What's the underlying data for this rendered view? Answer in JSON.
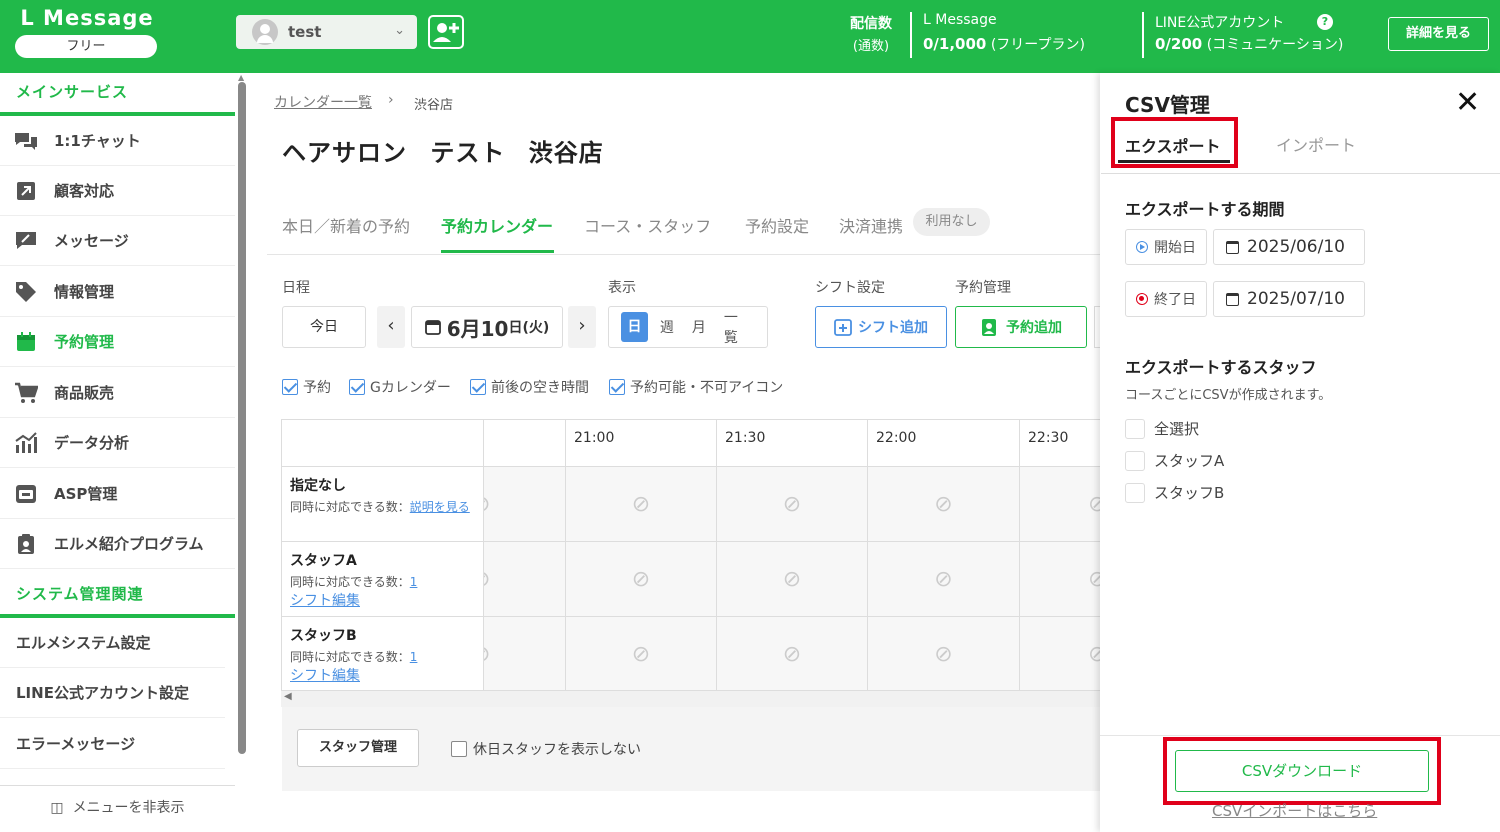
{
  "header": {
    "logo": "L Message",
    "plan": "フリー",
    "account": "test",
    "send_label": "配信数",
    "send_sub": "(通数)",
    "lmessage_title": "L Message",
    "lmessage_value": "0/1,000",
    "lmessage_plan": "(フリープラン)",
    "line_title": "LINE公式アカウント",
    "line_value": "0/200",
    "line_plan": "(コミュニケーション)",
    "help": "?",
    "detail_button": "詳細を見る"
  },
  "sidebar": {
    "section_main": "メインサービス",
    "items": [
      {
        "label": "1:1チャット",
        "icon": "chat-icon"
      },
      {
        "label": "顧客対応",
        "icon": "external-link-icon"
      },
      {
        "label": "メッセージ",
        "icon": "message-edit-icon"
      },
      {
        "label": "情報管理",
        "icon": "tag-icon"
      },
      {
        "label": "予約管理",
        "icon": "calendar-icon",
        "active": true
      },
      {
        "label": "商品販売",
        "icon": "cart-icon"
      },
      {
        "label": "データ分析",
        "icon": "chart-icon"
      },
      {
        "label": "ASP管理",
        "icon": "asp-icon"
      },
      {
        "label": "エルメ紹介プログラム",
        "icon": "clipboard-user-icon"
      }
    ],
    "section_system": "システム管理関連",
    "system_items": [
      "エルメシステム設定",
      "LINE公式アカウント設定",
      "エラーメッセージ"
    ],
    "hide_menu": "メニューを非表示"
  },
  "main": {
    "breadcrumb": [
      "カレンダー一覧",
      "渋谷店"
    ],
    "title": "ヘアサロン テスト 渋谷店",
    "tabs": [
      "本日／新着の予約",
      "予約カレンダー",
      "コース・スタッフ",
      "予約設定",
      "決済連携"
    ],
    "tab_badge": "利用なし",
    "schedule_label": "日程",
    "today": "今日",
    "date_main": "6月10",
    "date_suffix": "日(火)",
    "view_label": "表示",
    "views": [
      "日",
      "週",
      "月",
      "一覧"
    ],
    "shift_label": "シフト設定",
    "reserve_label": "予約管理",
    "shift_button": "シフト追加",
    "reserve_button": "予約追加",
    "checks": [
      "予約",
      "Gカレンダー",
      "前後の空き時間",
      "予約可能・不可アイコン"
    ],
    "times": [
      "21:00",
      "21:30",
      "22:00",
      "22:30"
    ],
    "rows": [
      {
        "name": "指定なし",
        "cap_label": "同時に対応できる数：",
        "cap_value": "説明を見る",
        "edit": ""
      },
      {
        "name": "スタッフA",
        "cap_label": "同時に対応できる数：",
        "cap_value": "1",
        "edit": "シフト編集"
      },
      {
        "name": "スタッフB",
        "cap_label": "同時に対応できる数：",
        "cap_value": "1",
        "edit": "シフト編集"
      }
    ],
    "staff_button": "スタッフ管理",
    "hide_off_staff": "休日スタッフを表示しない"
  },
  "panel": {
    "title": "CSV管理",
    "tab_export": "エクスポート",
    "tab_import": "インポート",
    "period_title": "エクスポートする期間",
    "start_label": "開始日",
    "start_date": "2025/06/10",
    "end_label": "終了日",
    "end_date": "2025/07/10",
    "staff_title": "エクスポートするスタッフ",
    "staff_note": "コースごとにCSVが作成されます。",
    "staff_options": [
      "全選択",
      "スタッフA",
      "スタッフB"
    ],
    "download_button": "CSVダウンロード",
    "import_link": "CSVインポートはこちら"
  },
  "colors": {
    "brand": "#21b94a",
    "accent_blue": "#4a90e2",
    "highlight": "#e0001a"
  }
}
